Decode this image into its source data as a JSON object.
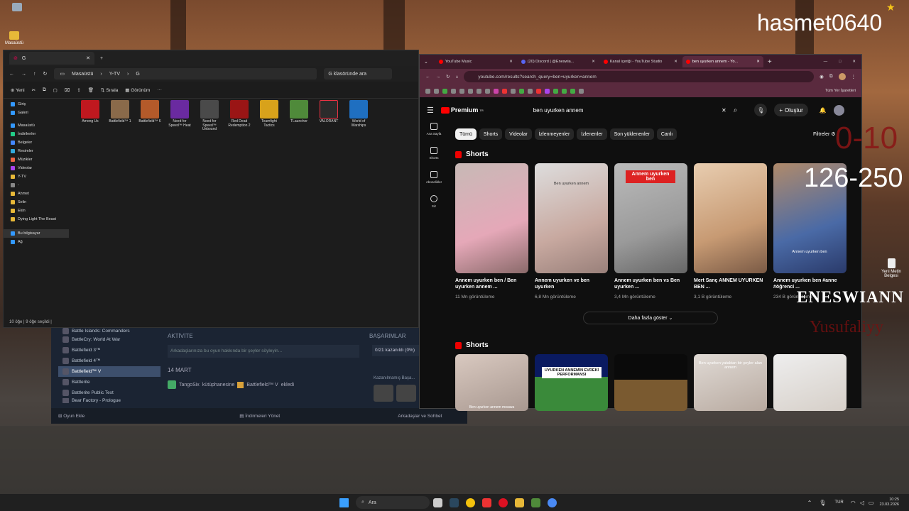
{
  "desktop": {
    "icons": [
      {
        "label": "Masaüstü"
      },
      {
        "label": "Yeni Metin Belgesi"
      }
    ]
  },
  "overlays": {
    "channel": "hasmet0640",
    "range1": "0-10",
    "range2": "126-250",
    "name1": "ENESWIANN",
    "name2": "Yusufaliyy"
  },
  "explorer": {
    "tab_title": "G",
    "path": [
      "Masaüstü",
      "Y-TV",
      "G"
    ],
    "search_placeholder": "G klasöründe ara",
    "cmd": {
      "new": "Yeni",
      "sort": "Sırala",
      "view": "Görünüm"
    },
    "sidebar": [
      "Giriş",
      "Galeri",
      "Masaüstü",
      "İndirilenler",
      "Belgeler",
      "Resimler",
      "Müzikler",
      "Videolar",
      "Y-TV",
      "-",
      "Ahmet",
      "Selin",
      "Ekin",
      "Dying Light The Beast",
      "Bu bilgisayar",
      "Ağ"
    ],
    "files": [
      {
        "label": "Among Us",
        "color": "#c0181f"
      },
      {
        "label": "Battlefield™ 1",
        "color": "#8a6a4a"
      },
      {
        "label": "Battlefield™ 6",
        "color": "#b45a2a"
      },
      {
        "label": "Need for Speed™ Heat",
        "color": "#6a2aa0"
      },
      {
        "label": "Need for Speed™ Unbound",
        "color": "#4a4a4a"
      },
      {
        "label": "Red Dead Redemption 2",
        "color": "#9a1515"
      },
      {
        "label": "Teamfight Tactics",
        "color": "#d8a21b"
      },
      {
        "label": "TLauncher",
        "color": "#4f8a3a"
      },
      {
        "label": "VALORANT",
        "color": "#2b2b2b"
      },
      {
        "label": "World of Warships",
        "color": "#1f6fc0"
      }
    ],
    "status": "10 öğe  |  9 öğe seçildi  |"
  },
  "steam": {
    "games": [
      "Battle Islands: Commanders",
      "BattleCry: World At War",
      "Battlefield 3™",
      "Battlefield 4™",
      "Battlefield™ V",
      "Battlerite",
      "Battlerite Public Test",
      "Bear Factory - Prologue"
    ],
    "selected": "Battlefield™ V",
    "activity_title": "AKTİVİTE",
    "activity_placeholder": "Arkadaşlarınıza bu oyun hakkında bir şeyler söyleyin...",
    "date": "14 MART",
    "event_user": "TangoSix",
    "event_text": "kütüphanesine",
    "event_game": "Battlefield™ V",
    "event_suffix": "ekledi",
    "ach_title": "BAŞARIMLAR",
    "ach_progress": "0/21 kazanıldı (0%)",
    "ach_locked": "Kazanılmamış Başa...",
    "add_game": "Oyun Ekle",
    "downloads": "İndirmeleri Yönet",
    "friends": "Arkadaşlar ve Sohbet"
  },
  "chrome": {
    "tabs": [
      {
        "title": "YouTube Music",
        "fav": "#f00"
      },
      {
        "title": "(20) Discord | @Eneswia...",
        "fav": "#5865f2"
      },
      {
        "title": "Kanal içeriği - YouTube Studio",
        "fav": "#f00"
      },
      {
        "title": "ben uyurken annem - Yo...",
        "fav": "#f00"
      }
    ],
    "url": "youtube.com/results?search_query=ben+uyurken+annem",
    "bookmarks_all": "Tüm Yer İşaretleri"
  },
  "youtube": {
    "logo": "Premium",
    "badge": "TR",
    "query": "ben uyurken annem",
    "create": "Oluştur",
    "nav": [
      "Ana Sayfa",
      "Shorts",
      "Abonelikler",
      "Siz"
    ],
    "chips": [
      "Tümü",
      "Shorts",
      "Videolar",
      "İzlenmeyenler",
      "İzlenenler",
      "Son yüklenenler",
      "Canlı"
    ],
    "filters": "Filtreler",
    "section": "Shorts",
    "shorts1": [
      {
        "title": "Annem uyurken ben / Ben uyurken annem ...",
        "views": "11 Mn görüntüleme",
        "overlay": ""
      },
      {
        "title": "Annem uyurken ve ben uyurken",
        "views": "6,8 Mn görüntüleme",
        "overlay": "Ben uyurken annem"
      },
      {
        "title": "Annem uyurken ben vs Ben uyurken ...",
        "views": "3,4 Mn görüntüleme",
        "overlay": "Annem uyurken ben"
      },
      {
        "title": "Mert Sanç ANNEM UYURKEN BEN ...",
        "views": "3,1 B görüntüleme",
        "overlay": ""
      },
      {
        "title": "Annem uyurken ben #anne #öğrenci ...",
        "views": "234 B görüntüleme",
        "overlay": "Annem uyurken ben"
      }
    ],
    "more": "Daha fazla göster",
    "shorts2": [
      {
        "overlay": "Ben uyurken annem mısawa"
      },
      {
        "overlay": "UYURKEN ANNEMİN EVDEKİ PERFORMANSI"
      },
      {
        "overlay": ""
      },
      {
        "overlay": "Ben uyurken yataktan bir şeyler alan annem"
      },
      {
        "overlay": ""
      }
    ]
  },
  "taskbar": {
    "search": "Ara",
    "lang": "TUR",
    "time": "10:25",
    "date": "23.03.2026"
  }
}
